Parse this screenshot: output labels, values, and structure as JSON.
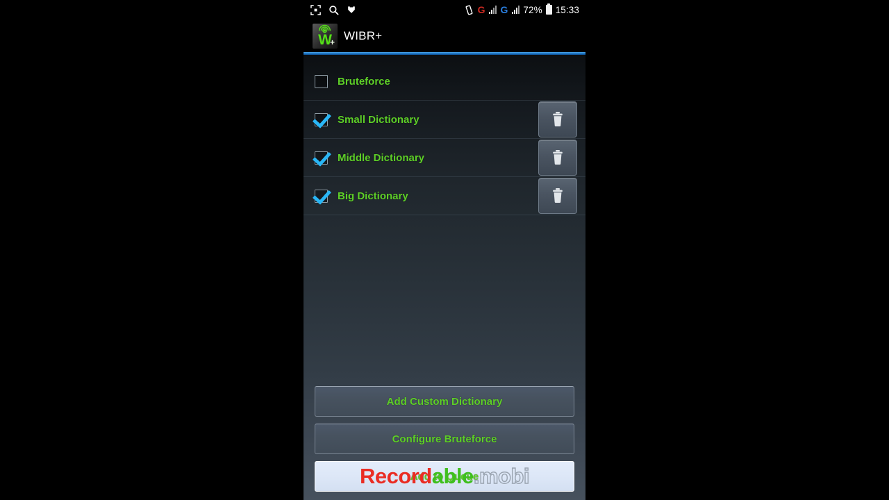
{
  "status_bar": {
    "left_icons": [
      {
        "name": "screenshot-capture-icon"
      },
      {
        "name": "search-icon"
      },
      {
        "name": "download-icon"
      }
    ],
    "right": {
      "vibrate_icon": "vibrate-icon",
      "sim1_label": "G",
      "sim1_color": "#d02a22",
      "sim2_label": "G",
      "sim2_color": "#2a7fe0",
      "battery_percent": "72%",
      "battery_icon": "battery-icon",
      "clock": "15:33"
    }
  },
  "action_bar": {
    "app_icon": "wibr-app-icon",
    "title": "WIBR+",
    "accent_color": "#1f78c8"
  },
  "theme": {
    "label_green": "#5ecf28",
    "check_blue": "#29b6f6",
    "button_slate": "#47525f"
  },
  "dictionary_list": [
    {
      "label": "Bruteforce",
      "checked": false,
      "has_delete": false,
      "delete_icon": "trash-icon"
    },
    {
      "label": "Small Dictionary",
      "checked": true,
      "has_delete": true,
      "delete_icon": "trash-icon"
    },
    {
      "label": "Middle Dictionary",
      "checked": true,
      "has_delete": true,
      "delete_icon": "trash-icon"
    },
    {
      "label": "Big Dictionary",
      "checked": true,
      "has_delete": true,
      "delete_icon": "trash-icon"
    }
  ],
  "bottom_buttons": {
    "add_custom_dictionary": "Add Custom Dictionary",
    "configure_bruteforce": "Configure Bruteforce",
    "add_to_queue": "Add to Queue"
  },
  "watermark": {
    "part1": "Record",
    "part2": "able",
    "part3": ".mobi"
  }
}
